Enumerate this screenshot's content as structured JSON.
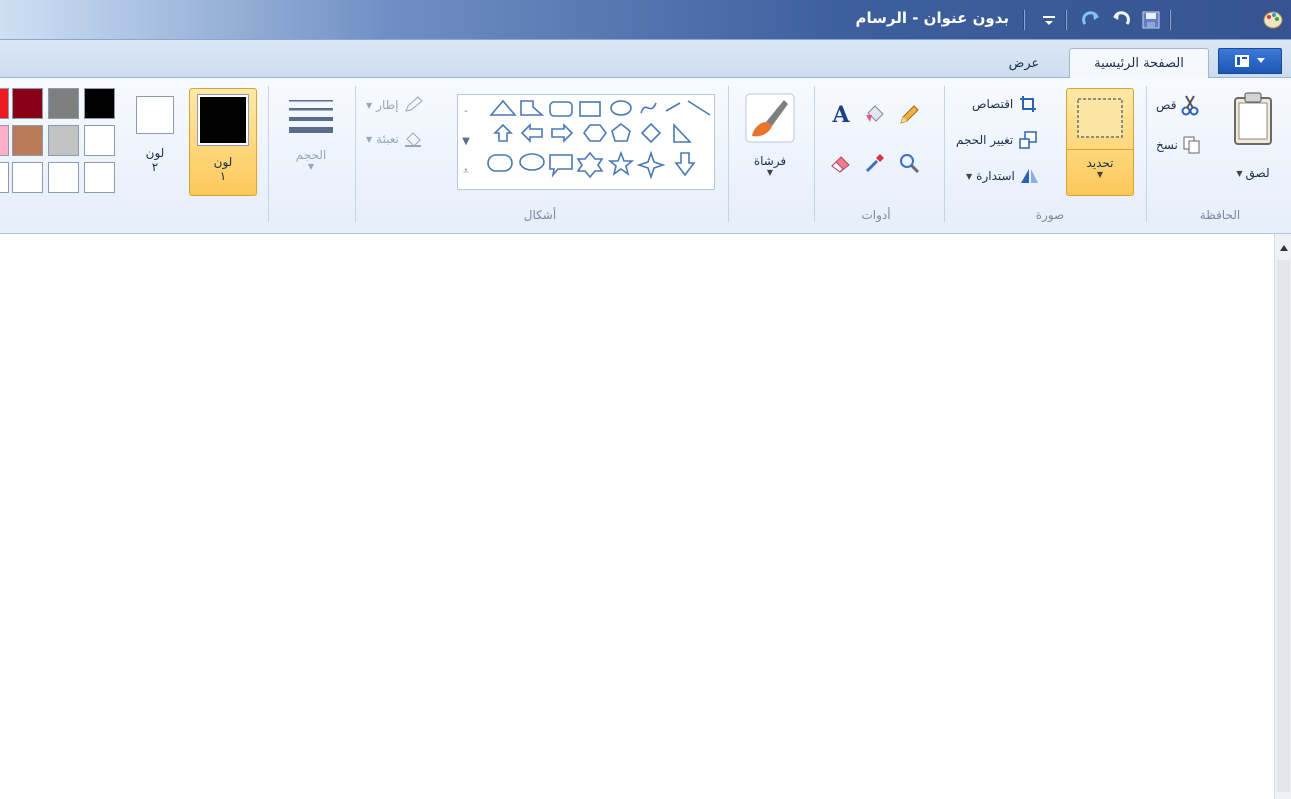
{
  "window": {
    "title": "بدون عنوان - الرسام"
  },
  "tabs": {
    "home": "الصفحة الرئيسية",
    "view": "عرض"
  },
  "clipboard": {
    "group_label": "الحافظة",
    "paste_label": "لصق",
    "cut_label": "قص",
    "copy_label": "نسخ"
  },
  "image": {
    "group_label": "صورة",
    "select_label": "تحديد",
    "crop_label": "اقتصاص",
    "resize_label": "تغيير الحجم",
    "rotate_label": "استدارة"
  },
  "tools": {
    "group_label": "أدوات"
  },
  "brushes": {
    "label": "فرشاة"
  },
  "shapes": {
    "group_label": "أشكال",
    "outline_label": "إطار",
    "fill_label": "تعبئة",
    "items": [
      "line",
      "curve",
      "oval",
      "rectangle",
      "rounded-rectangle",
      "polygon",
      "triangle",
      "right-triangle",
      "diamond",
      "pentagon",
      "hexagon",
      "right-arrow",
      "left-arrow",
      "up-arrow",
      "down-arrow",
      "four-point-star",
      "five-point-star",
      "six-point-star",
      "rounded-callout",
      "oval-callout",
      "cloud-callout"
    ]
  },
  "size": {
    "label": "الحجم"
  },
  "colors": {
    "color1_label": "لون",
    "color1_number": "١",
    "color2_label": "لون",
    "color2_number": "٢",
    "color1_value": "#000000",
    "color2_value": "#ffffff",
    "palette": [
      [
        "#000000",
        "#7f7f7f",
        "#880015"
      ],
      [
        "#ffffff",
        "#c3c3c3",
        "#b97a57"
      ],
      [
        "#ffffff",
        "#ffffff",
        "#ffffff"
      ]
    ]
  },
  "accent": {
    "title_bar": "#35548f",
    "selected_button": "#fcc95a",
    "tab_background": "#dbe7f6"
  }
}
